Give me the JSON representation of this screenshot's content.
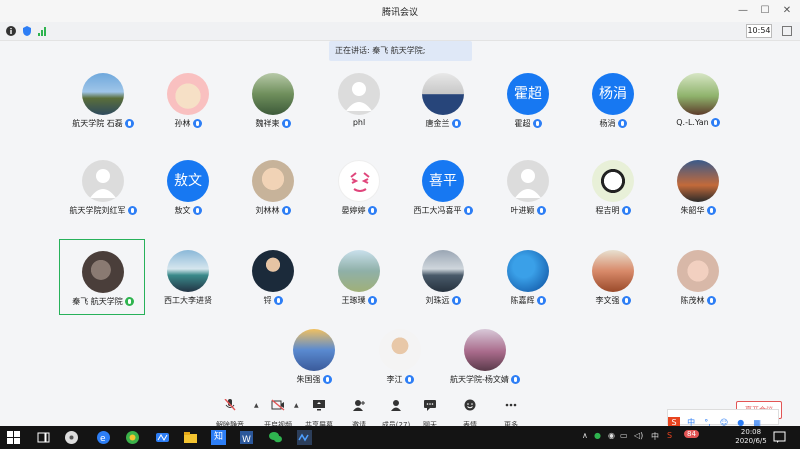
{
  "window": {
    "title": "腾讯会议",
    "time": "10:54"
  },
  "speaking": {
    "text": "正在讲话: 秦飞 航天学院;"
  },
  "participants": [
    {
      "name": "航天学院 石磊"
    },
    {
      "name": "孙林"
    },
    {
      "name": "魏祥柬"
    },
    {
      "name": "phl"
    },
    {
      "name": "唐金兰"
    },
    {
      "name": "霍超",
      "avatar_text": "霍超"
    },
    {
      "name": "杨涓",
      "avatar_text": "杨涓"
    },
    {
      "name": "Q.-L.Yan"
    },
    {
      "name": "航天学院刘红军"
    },
    {
      "name": "敖文",
      "avatar_text": "敖文"
    },
    {
      "name": "刘林林"
    },
    {
      "name": "晏婷婷"
    },
    {
      "name": "西工大冯喜平",
      "avatar_text": "喜平"
    },
    {
      "name": "叶进颖"
    },
    {
      "name": "程吉明"
    },
    {
      "name": "朱韶华"
    },
    {
      "name": "秦飞 航天学院"
    },
    {
      "name": "西工大李进贤"
    },
    {
      "name": "锊"
    },
    {
      "name": "王琢璞"
    },
    {
      "name": "刘珠远"
    },
    {
      "name": "陈嘉辉"
    },
    {
      "name": "李文强"
    },
    {
      "name": "陈茂林"
    },
    {
      "name": "朱国强"
    },
    {
      "name": "李江"
    },
    {
      "name": "航天学院-杨文婧"
    }
  ],
  "toolbar": {
    "unmute": "解除静音",
    "video": "开启视频",
    "share": "共享屏幕",
    "invite": "邀请",
    "members": "成员(27)",
    "chat": "聊天",
    "emoji": "表情",
    "more": "更多",
    "end": "离开会议"
  },
  "ime": {
    "lang": "中",
    "pinyin": "°,"
  },
  "taskbar": {
    "time": "20:08",
    "date": "2020/6/5",
    "notif": "84",
    "ime": "中",
    "app_label": "知"
  },
  "colors": {
    "accent": "#1778f2",
    "selected": "#27b15a",
    "end": "#e25555"
  }
}
